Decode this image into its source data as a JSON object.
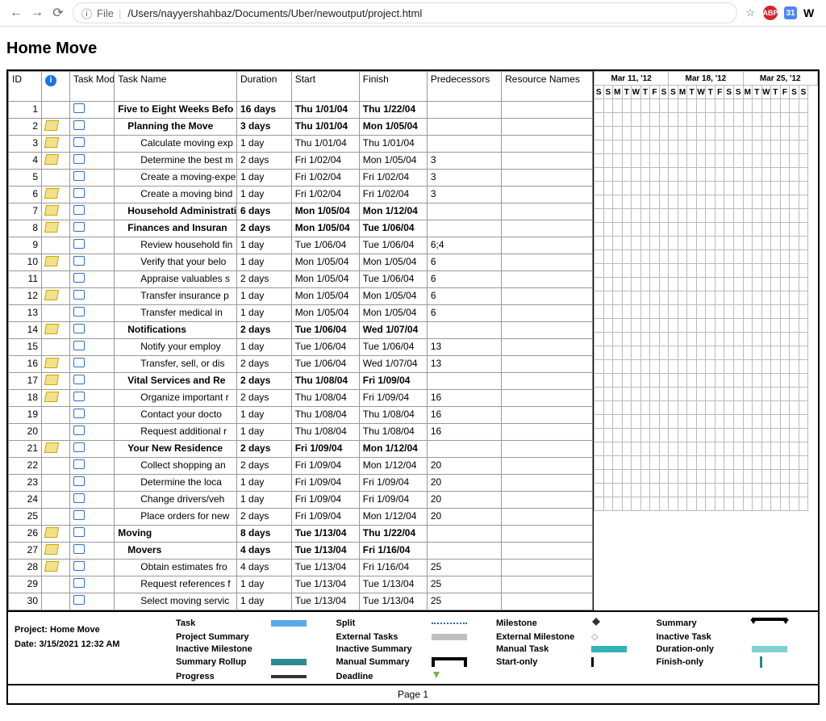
{
  "browser": {
    "url": "/Users/nayyershahbaz/Documents/Uber/newoutput/project.html",
    "file_label": "File",
    "ext": {
      "abp": "ABP",
      "sq": "31",
      "w": "W"
    }
  },
  "title": "Home Move",
  "headers": {
    "id": "ID",
    "mode": "Task Mode",
    "name": "Task Name",
    "dur": "Duration",
    "start": "Start",
    "finish": "Finish",
    "pred": "Predecessors",
    "res": "Resource Names"
  },
  "rows": [
    {
      "id": "1",
      "note": false,
      "bold": true,
      "ind": 0,
      "name": "Five to Eight Weeks Befo",
      "dur": "16 days",
      "start": "Thu 1/01/04",
      "finish": "Thu 1/22/04",
      "pred": ""
    },
    {
      "id": "2",
      "note": true,
      "bold": true,
      "ind": 1,
      "name": "Planning the Move",
      "dur": "3 days",
      "start": "Thu 1/01/04",
      "finish": "Mon 1/05/04",
      "pred": ""
    },
    {
      "id": "3",
      "note": true,
      "bold": false,
      "ind": 2,
      "name": "Calculate moving exp",
      "dur": "1 day",
      "start": "Thu 1/01/04",
      "finish": "Thu 1/01/04",
      "pred": ""
    },
    {
      "id": "4",
      "note": true,
      "bold": false,
      "ind": 2,
      "name": "Determine the best m",
      "dur": "2 days",
      "start": "Fri 1/02/04",
      "finish": "Mon 1/05/04",
      "pred": "3"
    },
    {
      "id": "5",
      "note": false,
      "bold": false,
      "ind": 2,
      "name": "Create a moving-expe",
      "dur": "1 day",
      "start": "Fri 1/02/04",
      "finish": "Fri 1/02/04",
      "pred": "3"
    },
    {
      "id": "6",
      "note": true,
      "bold": false,
      "ind": 2,
      "name": "Create a moving bind",
      "dur": "1 day",
      "start": "Fri 1/02/04",
      "finish": "Fri 1/02/04",
      "pred": "3"
    },
    {
      "id": "7",
      "note": true,
      "bold": true,
      "ind": 1,
      "name": "Household Administratio",
      "dur": "6 days",
      "start": "Mon 1/05/04",
      "finish": "Mon 1/12/04",
      "pred": ""
    },
    {
      "id": "8",
      "note": true,
      "bold": true,
      "ind": 1,
      "name": "Finances and Insuran",
      "dur": "2 days",
      "start": "Mon 1/05/04",
      "finish": "Tue 1/06/04",
      "pred": ""
    },
    {
      "id": "9",
      "note": false,
      "bold": false,
      "ind": 2,
      "name": "Review household fin",
      "dur": "1 day",
      "start": "Tue 1/06/04",
      "finish": "Tue 1/06/04",
      "pred": "6;4"
    },
    {
      "id": "10",
      "note": true,
      "bold": false,
      "ind": 2,
      "name": "Verify that your belo",
      "dur": "1 day",
      "start": "Mon 1/05/04",
      "finish": "Mon 1/05/04",
      "pred": "6"
    },
    {
      "id": "11",
      "note": false,
      "bold": false,
      "ind": 2,
      "name": "Appraise valuables s",
      "dur": "2 days",
      "start": "Mon 1/05/04",
      "finish": "Tue 1/06/04",
      "pred": "6"
    },
    {
      "id": "12",
      "note": true,
      "bold": false,
      "ind": 2,
      "name": "Transfer insurance p",
      "dur": "1 day",
      "start": "Mon 1/05/04",
      "finish": "Mon 1/05/04",
      "pred": "6"
    },
    {
      "id": "13",
      "note": false,
      "bold": false,
      "ind": 2,
      "name": "Transfer medical in",
      "dur": "1 day",
      "start": "Mon 1/05/04",
      "finish": "Mon 1/05/04",
      "pred": "6"
    },
    {
      "id": "14",
      "note": true,
      "bold": true,
      "ind": 1,
      "name": "Notifications",
      "dur": "2 days",
      "start": "Tue 1/06/04",
      "finish": "Wed 1/07/04",
      "pred": ""
    },
    {
      "id": "15",
      "note": false,
      "bold": false,
      "ind": 2,
      "name": "Notify your employ",
      "dur": "1 day",
      "start": "Tue 1/06/04",
      "finish": "Tue 1/06/04",
      "pred": "13"
    },
    {
      "id": "16",
      "note": true,
      "bold": false,
      "ind": 2,
      "name": "Transfer, sell, or dis",
      "dur": "2 days",
      "start": "Tue 1/06/04",
      "finish": "Wed 1/07/04",
      "pred": "13"
    },
    {
      "id": "17",
      "note": true,
      "bold": true,
      "ind": 1,
      "name": "Vital Services and Re",
      "dur": "2 days",
      "start": "Thu 1/08/04",
      "finish": "Fri 1/09/04",
      "pred": ""
    },
    {
      "id": "18",
      "note": true,
      "bold": false,
      "ind": 2,
      "name": "Organize important r",
      "dur": "2 days",
      "start": "Thu 1/08/04",
      "finish": "Fri 1/09/04",
      "pred": "16"
    },
    {
      "id": "19",
      "note": false,
      "bold": false,
      "ind": 2,
      "name": "Contact your docto",
      "dur": "1 day",
      "start": "Thu 1/08/04",
      "finish": "Thu 1/08/04",
      "pred": "16"
    },
    {
      "id": "20",
      "note": false,
      "bold": false,
      "ind": 2,
      "name": "Request additional r",
      "dur": "1 day",
      "start": "Thu 1/08/04",
      "finish": "Thu 1/08/04",
      "pred": "16"
    },
    {
      "id": "21",
      "note": true,
      "bold": true,
      "ind": 1,
      "name": "Your New Residence",
      "dur": "2 days",
      "start": "Fri 1/09/04",
      "finish": "Mon 1/12/04",
      "pred": ""
    },
    {
      "id": "22",
      "note": false,
      "bold": false,
      "ind": 2,
      "name": "Collect shopping an",
      "dur": "2 days",
      "start": "Fri 1/09/04",
      "finish": "Mon 1/12/04",
      "pred": "20"
    },
    {
      "id": "23",
      "note": false,
      "bold": false,
      "ind": 2,
      "name": "Determine the loca",
      "dur": "1 day",
      "start": "Fri 1/09/04",
      "finish": "Fri 1/09/04",
      "pred": "20"
    },
    {
      "id": "24",
      "note": false,
      "bold": false,
      "ind": 2,
      "name": "Change drivers/veh",
      "dur": "1 day",
      "start": "Fri 1/09/04",
      "finish": "Fri 1/09/04",
      "pred": "20"
    },
    {
      "id": "25",
      "note": false,
      "bold": false,
      "ind": 2,
      "name": "Place orders for new",
      "dur": "2 days",
      "start": "Fri 1/09/04",
      "finish": "Mon 1/12/04",
      "pred": "20"
    },
    {
      "id": "26",
      "note": true,
      "bold": true,
      "ind": 0,
      "name": "Moving",
      "dur": "8 days",
      "start": "Tue 1/13/04",
      "finish": "Thu 1/22/04",
      "pred": ""
    },
    {
      "id": "27",
      "note": true,
      "bold": true,
      "ind": 1,
      "name": "Movers",
      "dur": "4 days",
      "start": "Tue 1/13/04",
      "finish": "Fri 1/16/04",
      "pred": ""
    },
    {
      "id": "28",
      "note": true,
      "bold": false,
      "ind": 2,
      "name": "Obtain estimates fro",
      "dur": "4 days",
      "start": "Tue 1/13/04",
      "finish": "Fri 1/16/04",
      "pred": "25"
    },
    {
      "id": "29",
      "note": false,
      "bold": false,
      "ind": 2,
      "name": "Request references f",
      "dur": "1 day",
      "start": "Tue 1/13/04",
      "finish": "Tue 1/13/04",
      "pred": "25"
    },
    {
      "id": "30",
      "note": false,
      "bold": false,
      "ind": 2,
      "name": "Select moving servic",
      "dur": "1 day",
      "start": "Tue 1/13/04",
      "finish": "Tue 1/13/04",
      "pred": "25"
    }
  ],
  "timeline": {
    "weeks": [
      "Mar 11, '12",
      "Mar 18, '12",
      "Mar 25, '12"
    ],
    "days": [
      "S",
      "S",
      "M",
      "T",
      "W",
      "T",
      "F",
      "S",
      "S",
      "M",
      "T",
      "W",
      "T",
      "F",
      "S",
      "S",
      "M",
      "T",
      "W",
      "T",
      "F",
      "S",
      "S"
    ]
  },
  "legend": {
    "project_label": "Project: Home Move",
    "date_label": "Date: 3/15/2021 12:32 AM",
    "items": {
      "task": "Task",
      "ext": "External Tasks",
      "man": "Manual Task",
      "fin": "Finish-only",
      "split": "Split",
      "extm": "External Milestone",
      "dur": "Duration-only",
      "prog": "Progress",
      "ms": "Milestone",
      "inact": "Inactive Task",
      "roll": "Summary Rollup",
      "dl": "Deadline",
      "summ": "Summary",
      "ims": "Inactive Milestone",
      "msumm": "Manual Summary",
      "psumm": "Project Summary",
      "isumm": "Inactive Summary",
      "start": "Start-only"
    }
  },
  "footer": "Page 1",
  "info_glyph": "i"
}
